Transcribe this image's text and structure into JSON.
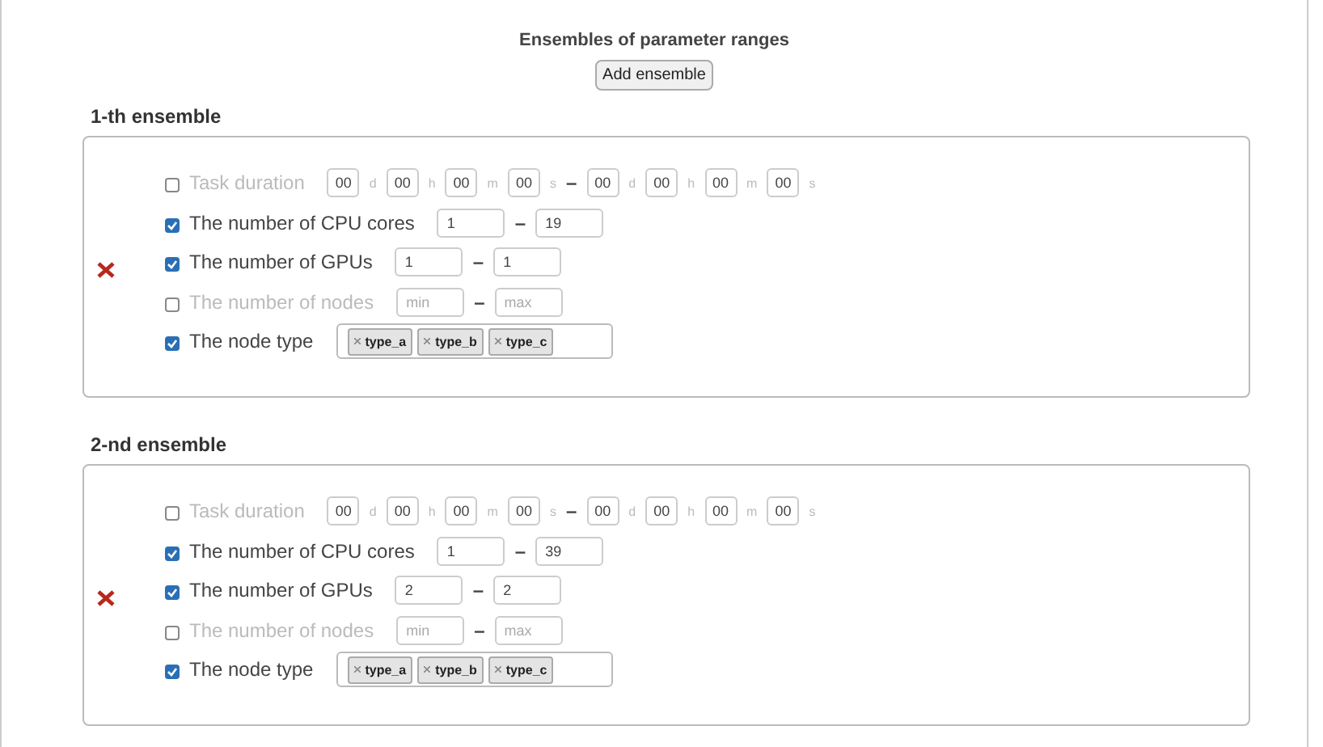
{
  "title": "Ensembles of parameter ranges",
  "add_button": "Add ensemble",
  "ensembles": [
    {
      "title": "1-th ensemble",
      "rows": [
        {
          "kind": "duration",
          "label": "Task duration",
          "checked": false,
          "from": [
            {
              "value": "00",
              "unit": "d"
            },
            {
              "value": "00",
              "unit": "h"
            },
            {
              "value": "00",
              "unit": "m"
            },
            {
              "value": "00",
              "unit": "s"
            }
          ],
          "separator": "–",
          "to": [
            {
              "value": "00",
              "unit": "d"
            },
            {
              "value": "00",
              "unit": "h"
            },
            {
              "value": "00",
              "unit": "m"
            },
            {
              "value": "00",
              "unit": "s"
            }
          ]
        },
        {
          "kind": "range",
          "label": "The number of CPU cores",
          "checked": true,
          "min": {
            "value": "1"
          },
          "separator": "–",
          "max": {
            "value": "19"
          }
        },
        {
          "kind": "range",
          "label": "The number of GPUs",
          "checked": true,
          "min": {
            "value": "1"
          },
          "separator": "–",
          "max": {
            "value": "1"
          }
        },
        {
          "kind": "range",
          "label": "The number of nodes",
          "checked": false,
          "min": {
            "placeholder": "min"
          },
          "separator": "–",
          "max": {
            "placeholder": "max"
          }
        },
        {
          "kind": "tags",
          "label": "The node type",
          "checked": true,
          "tags": [
            "type_a",
            "type_b",
            "type_c"
          ]
        }
      ]
    },
    {
      "title": "2-nd ensemble",
      "rows": [
        {
          "kind": "duration",
          "label": "Task duration",
          "checked": false,
          "from": [
            {
              "value": "00",
              "unit": "d"
            },
            {
              "value": "00",
              "unit": "h"
            },
            {
              "value": "00",
              "unit": "m"
            },
            {
              "value": "00",
              "unit": "s"
            }
          ],
          "separator": "–",
          "to": [
            {
              "value": "00",
              "unit": "d"
            },
            {
              "value": "00",
              "unit": "h"
            },
            {
              "value": "00",
              "unit": "m"
            },
            {
              "value": "00",
              "unit": "s"
            }
          ]
        },
        {
          "kind": "range",
          "label": "The number of CPU cores",
          "checked": true,
          "min": {
            "value": "1"
          },
          "separator": "–",
          "max": {
            "value": "39"
          }
        },
        {
          "kind": "range",
          "label": "The number of GPUs",
          "checked": true,
          "min": {
            "value": "2"
          },
          "separator": "–",
          "max": {
            "value": "2"
          }
        },
        {
          "kind": "range",
          "label": "The number of nodes",
          "checked": false,
          "min": {
            "placeholder": "min"
          },
          "separator": "–",
          "max": {
            "placeholder": "max"
          }
        },
        {
          "kind": "tags",
          "label": "The node type",
          "checked": true,
          "tags": [
            "type_a",
            "type_b",
            "type_c"
          ]
        }
      ]
    }
  ]
}
